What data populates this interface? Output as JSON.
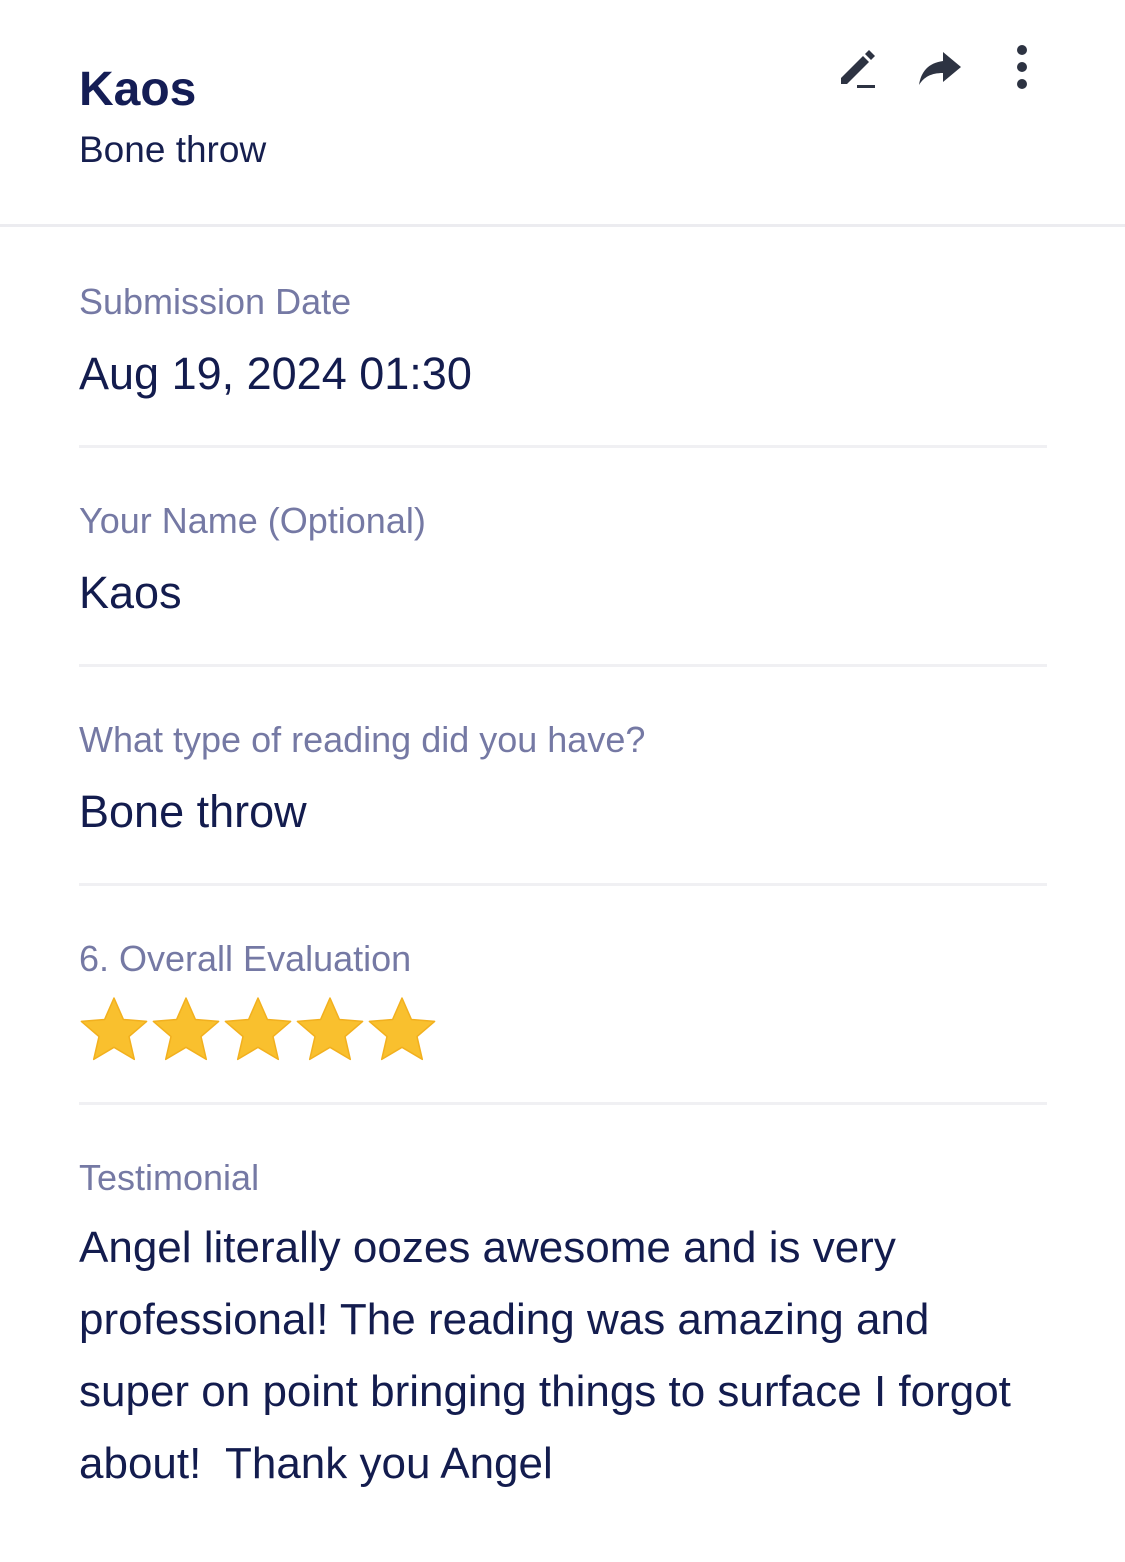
{
  "header": {
    "title": "Kaos",
    "subtitle": "Bone throw",
    "actions": [
      {
        "name": "edit",
        "icon": "pencil-icon"
      },
      {
        "name": "share",
        "icon": "share-arrow-icon"
      },
      {
        "name": "more",
        "icon": "more-vertical-icon"
      }
    ]
  },
  "fields": {
    "submission_date": {
      "label": "Submission Date",
      "value": "Aug 19, 2024 01:30"
    },
    "your_name": {
      "label": "Your Name (Optional)",
      "value": "Kaos"
    },
    "reading_type": {
      "label": "What type of reading did you have?",
      "value": "Bone throw"
    },
    "overall_evaluation": {
      "label": "6. Overall Evaluation",
      "rating": 5,
      "max_rating": 5
    },
    "testimonial": {
      "label": "Testimonial",
      "value": "Angel literally oozes awesome and is very professional! The reading was amazing and super on point bringing things to surface I forgot about!  Thank you Angel"
    }
  },
  "colors": {
    "title": "#141d55",
    "label": "#7579a4",
    "value": "#131c4e",
    "star": "#f9c02e",
    "divider": "#f0f0f3"
  }
}
